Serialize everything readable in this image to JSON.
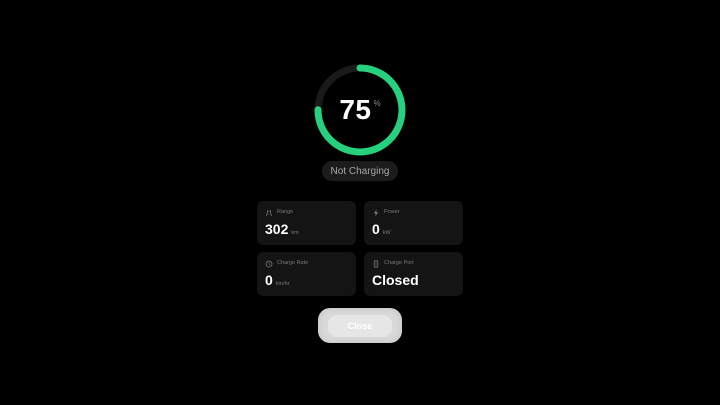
{
  "battery": {
    "percent_value": "75",
    "percent_unit": "%",
    "fraction": 0.75,
    "ring_color": "#26d07c",
    "track_color": "#1a1a1a"
  },
  "status": {
    "label": "Not Charging"
  },
  "stats": {
    "range": {
      "icon": "range-icon",
      "label": "Range",
      "value": "302",
      "unit": "km"
    },
    "power": {
      "icon": "lightning-icon",
      "label": "Power",
      "value": "0",
      "unit": "kW"
    },
    "charge_rate": {
      "icon": "clock-icon",
      "label": "Charge Rate",
      "value": "0",
      "unit": "km/hr"
    },
    "charge_port": {
      "icon": "plug-icon",
      "label": "Charge Port",
      "value": "Closed"
    }
  },
  "actions": {
    "close_label": "Close"
  }
}
